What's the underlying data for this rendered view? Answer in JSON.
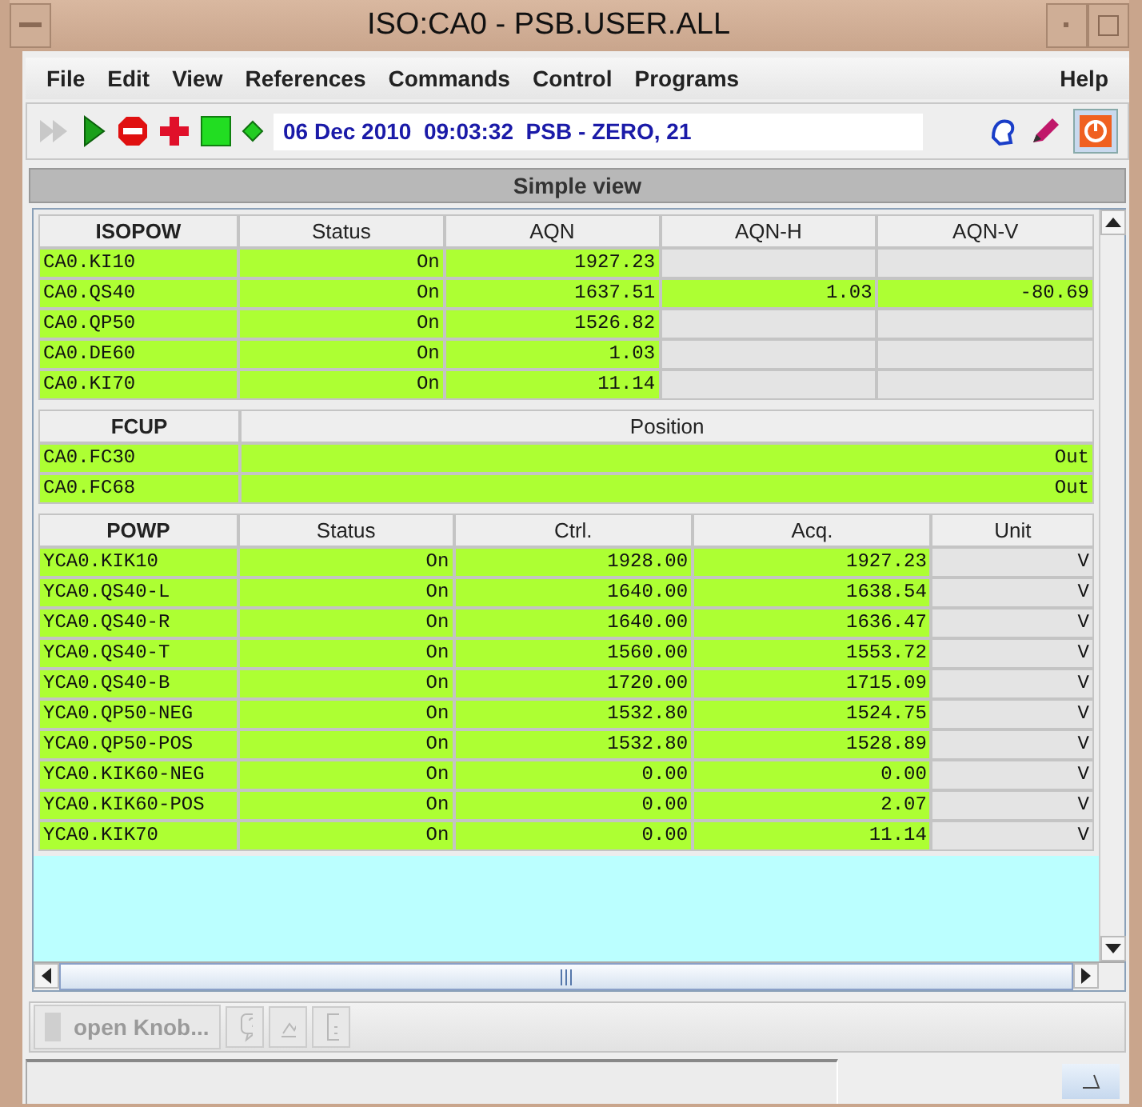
{
  "window": {
    "title": "ISO:CA0 - PSB.USER.ALL"
  },
  "menu": [
    {
      "label": "File"
    },
    {
      "label": "Edit"
    },
    {
      "label": "View"
    },
    {
      "label": "References"
    },
    {
      "label": "Commands"
    },
    {
      "label": "Control"
    },
    {
      "label": "Programs"
    },
    {
      "label": "Help",
      "kind": "right"
    }
  ],
  "status_line": "06 Dec 2010  09:03:32  PSB - ZERO, 21",
  "view_title": "Simple view",
  "sections": [
    {
      "columns": [
        "ISOPOW",
        "Status",
        "AQN",
        "AQN-H",
        "AQN-V"
      ],
      "rows": [
        {
          "cells": [
            {
              "text": "CA0.KI10",
              "highlighted": true
            },
            {
              "text": "On",
              "highlighted": true
            },
            {
              "text": "1927.23",
              "highlighted": true
            },
            {
              "highlighted": false
            },
            {
              "highlighted": false
            }
          ]
        },
        {
          "cells": [
            {
              "text": "CA0.QS40",
              "highlighted": true
            },
            {
              "text": "On",
              "highlighted": true
            },
            {
              "text": "1637.51",
              "highlighted": true
            },
            {
              "text": "1.03",
              "highlighted": true
            },
            {
              "text": "-80.69",
              "highlighted": true
            }
          ]
        },
        {
          "cells": [
            {
              "text": "CA0.QP50",
              "highlighted": true
            },
            {
              "text": "On",
              "highlighted": true
            },
            {
              "text": "1526.82",
              "highlighted": true
            },
            {
              "highlighted": false
            },
            {
              "highlighted": false
            }
          ]
        },
        {
          "cells": [
            {
              "text": "CA0.DE60",
              "highlighted": true
            },
            {
              "text": "On",
              "highlighted": true
            },
            {
              "text": "1.03",
              "highlighted": true
            },
            {
              "highlighted": false
            },
            {
              "highlighted": false
            }
          ]
        },
        {
          "cells": [
            {
              "text": "CA0.KI70",
              "highlighted": true
            },
            {
              "text": "On",
              "highlighted": true
            },
            {
              "text": "11.14",
              "highlighted": true
            },
            {
              "highlighted": false
            },
            {
              "highlighted": false
            }
          ]
        }
      ]
    },
    {
      "columns": [
        "FCUP",
        "Position"
      ],
      "rows": [
        {
          "cells": [
            {
              "text": "CA0.FC30",
              "highlighted": true
            },
            {
              "text": "Out",
              "highlighted": true
            }
          ]
        },
        {
          "cells": [
            {
              "text": "CA0.FC68",
              "highlighted": true
            },
            {
              "text": "Out",
              "highlighted": true
            }
          ]
        }
      ]
    },
    {
      "columns": [
        "POWP",
        "Status",
        "Ctrl.",
        "Acq.",
        "Unit"
      ],
      "rows": [
        {
          "cells": [
            {
              "text": "YCA0.KIK10",
              "highlighted": true
            },
            {
              "text": "On",
              "highlighted": true
            },
            {
              "text": "1928.00",
              "highlighted": true
            },
            {
              "text": "1927.23",
              "highlighted": true
            },
            {
              "text": "V",
              "highlighted": false
            }
          ]
        },
        {
          "cells": [
            {
              "text": "YCA0.QS40-L",
              "highlighted": true
            },
            {
              "text": "On",
              "highlighted": true
            },
            {
              "text": "1640.00",
              "highlighted": true
            },
            {
              "text": "1638.54",
              "highlighted": true
            },
            {
              "text": "V",
              "highlighted": false
            }
          ]
        },
        {
          "cells": [
            {
              "text": "YCA0.QS40-R",
              "highlighted": true
            },
            {
              "text": "On",
              "highlighted": true
            },
            {
              "text": "1640.00",
              "highlighted": true
            },
            {
              "text": "1636.47",
              "highlighted": true
            },
            {
              "text": "V",
              "highlighted": false
            }
          ]
        },
        {
          "cells": [
            {
              "text": "YCA0.QS40-T",
              "highlighted": true
            },
            {
              "text": "On",
              "highlighted": true
            },
            {
              "text": "1560.00",
              "highlighted": true
            },
            {
              "text": "1553.72",
              "highlighted": true
            },
            {
              "text": "V",
              "highlighted": false
            }
          ]
        },
        {
          "cells": [
            {
              "text": "YCA0.QS40-B",
              "highlighted": true
            },
            {
              "text": "On",
              "highlighted": true
            },
            {
              "text": "1720.00",
              "highlighted": true
            },
            {
              "text": "1715.09",
              "highlighted": true
            },
            {
              "text": "V",
              "highlighted": false
            }
          ]
        },
        {
          "cells": [
            {
              "text": "YCA0.QP50-NEG",
              "highlighted": true
            },
            {
              "text": "On",
              "highlighted": true
            },
            {
              "text": "1532.80",
              "highlighted": true
            },
            {
              "text": "1524.75",
              "highlighted": true
            },
            {
              "text": "V",
              "highlighted": false
            }
          ]
        },
        {
          "cells": [
            {
              "text": "YCA0.QP50-POS",
              "highlighted": true
            },
            {
              "text": "On",
              "highlighted": true
            },
            {
              "text": "1532.80",
              "highlighted": true
            },
            {
              "text": "1528.89",
              "highlighted": true
            },
            {
              "text": "V",
              "highlighted": false
            }
          ]
        },
        {
          "cells": [
            {
              "text": "YCA0.KIK60-NEG",
              "highlighted": true
            },
            {
              "text": "On",
              "highlighted": true
            },
            {
              "text": "0.00",
              "highlighted": true
            },
            {
              "text": "0.00",
              "highlighted": true
            },
            {
              "text": "V",
              "highlighted": false
            }
          ]
        },
        {
          "cells": [
            {
              "text": "YCA0.KIK60-POS",
              "highlighted": true
            },
            {
              "text": "On",
              "highlighted": true
            },
            {
              "text": "0.00",
              "highlighted": true
            },
            {
              "text": "2.07",
              "highlighted": true
            },
            {
              "text": "V",
              "highlighted": false
            }
          ]
        },
        {
          "cells": [
            {
              "text": "YCA0.KIK70",
              "highlighted": true
            },
            {
              "text": "On",
              "highlighted": true
            },
            {
              "text": "0.00",
              "highlighted": true
            },
            {
              "text": "11.14",
              "highlighted": true
            },
            {
              "text": "V",
              "highlighted": false
            }
          ]
        }
      ]
    }
  ],
  "bottom_toolbar": {
    "open_button": {
      "label": "open Knob...",
      "disabled": true
    },
    "icon_buttons_disabled": true
  }
}
